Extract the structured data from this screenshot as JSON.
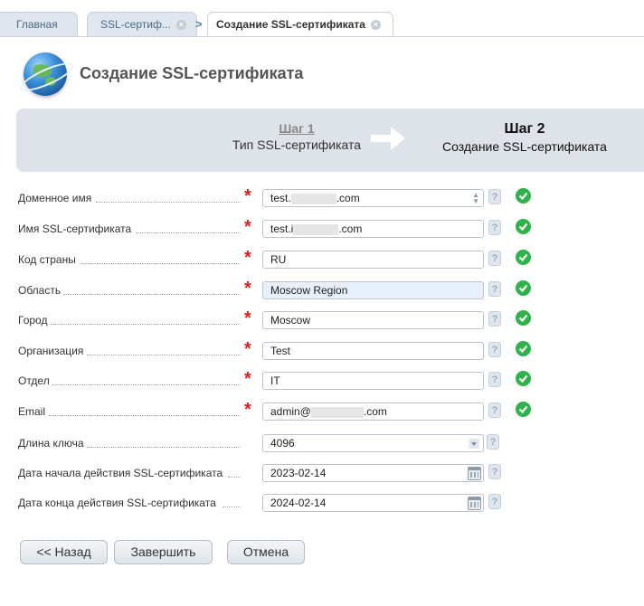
{
  "tabs": [
    {
      "label": "Главная"
    },
    {
      "label": "SSL-сертиф..."
    },
    {
      "label": "Создание SSL-сертификата"
    }
  ],
  "breadcrumb_separator": ">",
  "page": {
    "title": "Создание SSL-сертификата"
  },
  "wizard": {
    "step1": {
      "number": "Шаг 1",
      "label": "Тип SSL-сертификата"
    },
    "step2": {
      "number": "Шаг 2",
      "label": "Создание SSL-сертификата"
    }
  },
  "form": {
    "fields": [
      {
        "label": "Доменное имя",
        "value_prefix": "test.",
        "value_suffix": ".com",
        "required": "*"
      },
      {
        "label": "Имя SSL-сертификата",
        "value_prefix": "test.i",
        "value_suffix": ".com",
        "required": "*"
      },
      {
        "label": "Код страны",
        "value": "RU",
        "required": "*"
      },
      {
        "label": "Область",
        "value": "Moscow Region",
        "required": "*"
      },
      {
        "label": "Город",
        "value": "Moscow",
        "required": "*"
      },
      {
        "label": "Организация",
        "value": "Test",
        "required": "*"
      },
      {
        "label": "Отдел",
        "value": "IT",
        "required": "*"
      },
      {
        "label": "Email",
        "value_prefix": "admin@",
        "value_suffix": ".com",
        "required": "*"
      },
      {
        "label": "Длина ключа",
        "value": "4096"
      },
      {
        "label": "Дата начала действия SSL-сертификата",
        "value": "2023-02-14"
      },
      {
        "label": "Дата конца действия SSL-сертификата",
        "value": "2024-02-14"
      }
    ],
    "help_glyph": "?"
  },
  "buttons": {
    "back": "<< Назад",
    "finish": "Завершить",
    "cancel": "Отмена"
  },
  "colors": {
    "required": "#e01e1e",
    "valid": "#2db34a",
    "wizard_bg": "#dde3e9"
  }
}
